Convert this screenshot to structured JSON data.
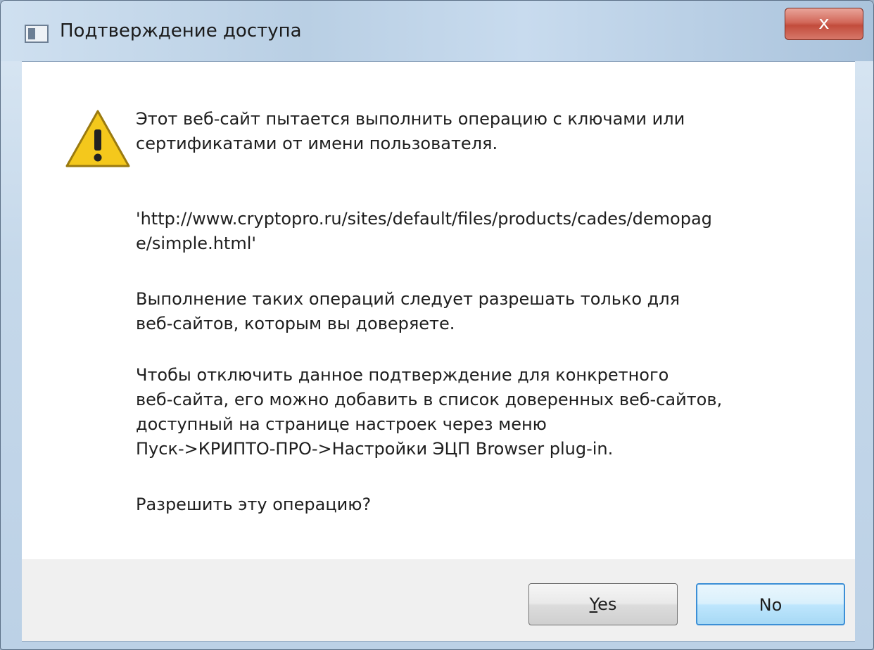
{
  "window": {
    "title": "Подтверждение доступа",
    "close_glyph": "x"
  },
  "message": {
    "p1_l1": "Этот веб-сайт пытается выполнить операцию с ключами или",
    "p1_l2": "сертификатами от имени пользователя.",
    "url_l1": "'http://www.cryptopro.ru/sites/default/files/products/cades/demopag",
    "url_l2": "e/simple.html'",
    "p3_l1": "Выполнение таких операций следует разрешать только для",
    "p3_l2": "веб-сайтов, которым вы доверяете.",
    "p4_l1": "Чтобы отключить данное подтверждение для конкретного",
    "p4_l2": "веб-сайта, его можно добавить в список доверенных веб-сайтов,",
    "p4_l3": "доступный на странице настроек через меню",
    "p4_l4": "Пуск->КРИПТО-ПРО->Настройки ЭЦП Browser plug-in.",
    "question": "Разрешить эту операцию?"
  },
  "buttons": {
    "yes_mnemonic": "Y",
    "yes_rest": "es",
    "no": "No"
  },
  "icons": {
    "warning": "warning-icon",
    "app": "app-window-icon",
    "close": "close-icon"
  }
}
